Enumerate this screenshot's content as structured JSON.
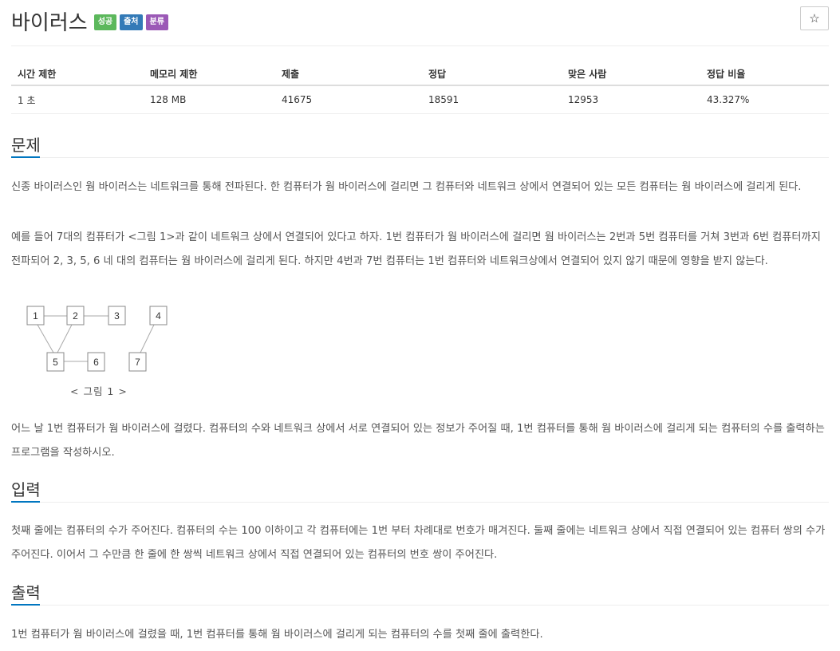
{
  "problem": {
    "title": "바이러스",
    "badges": [
      {
        "label": "성공",
        "color": "#5cb85c"
      },
      {
        "label": "출처",
        "color": "#337ab7"
      },
      {
        "label": "분류",
        "color": "#9b59b6"
      }
    ],
    "star_glyph": "☆"
  },
  "stats": {
    "headers": [
      "시간 제한",
      "메모리 제한",
      "제출",
      "정답",
      "맞은 사람",
      "정답 비율"
    ],
    "values": [
      "1 초",
      "128 MB",
      "41675",
      "18591",
      "12953",
      "43.327%"
    ]
  },
  "sections": {
    "description": {
      "heading": "문제",
      "p1": "신종 바이러스인 웜 바이러스는 네트워크를 통해 전파된다. 한 컴퓨터가 웜 바이러스에 걸리면 그 컴퓨터와 네트워크 상에서 연결되어 있는 모든 컴퓨터는 웜 바이러스에 걸리게 된다.",
      "p2": "예를 들어 7대의 컴퓨터가 <그림 1>과 같이 네트워크 상에서 연결되어 있다고 하자. 1번 컴퓨터가 웜 바이러스에 걸리면 웜 바이러스는 2번과 5번 컴퓨터를 거쳐 3번과 6번 컴퓨터까지 전파되어 2, 3, 5, 6 네 대의 컴퓨터는 웜 바이러스에 걸리게 된다. 하지만 4번과 7번 컴퓨터는 1번 컴퓨터와 네트워크상에서 연결되어 있지 않기 때문에 영향을 받지 않는다.",
      "figure": {
        "nodes": [
          "1",
          "2",
          "3",
          "4",
          "5",
          "6",
          "7"
        ],
        "caption": "< 그림 1 >"
      },
      "p3": "어느 날 1번 컴퓨터가 웜 바이러스에 걸렸다. 컴퓨터의 수와 네트워크 상에서 서로 연결되어 있는 정보가 주어질 때, 1번 컴퓨터를 통해 웜 바이러스에 걸리게 되는 컴퓨터의 수를 출력하는 프로그램을 작성하시오."
    },
    "input": {
      "heading": "입력",
      "p1": "첫째 줄에는 컴퓨터의 수가 주어진다. 컴퓨터의 수는 100 이하이고 각 컴퓨터에는 1번 부터 차례대로 번호가 매겨진다. 둘째 줄에는 네트워크 상에서 직접 연결되어 있는 컴퓨터 쌍의 수가 주어진다. 이어서 그 수만큼 한 줄에 한 쌍씩 네트워크 상에서 직접 연결되어 있는 컴퓨터의 번호 쌍이 주어진다."
    },
    "output": {
      "heading": "출력",
      "p1": "1번 컴퓨터가 웜 바이러스에 걸렸을 때, 1번 컴퓨터를 통해 웜 바이러스에 걸리게 되는 컴퓨터의 수를 첫째 줄에 출력한다."
    }
  }
}
